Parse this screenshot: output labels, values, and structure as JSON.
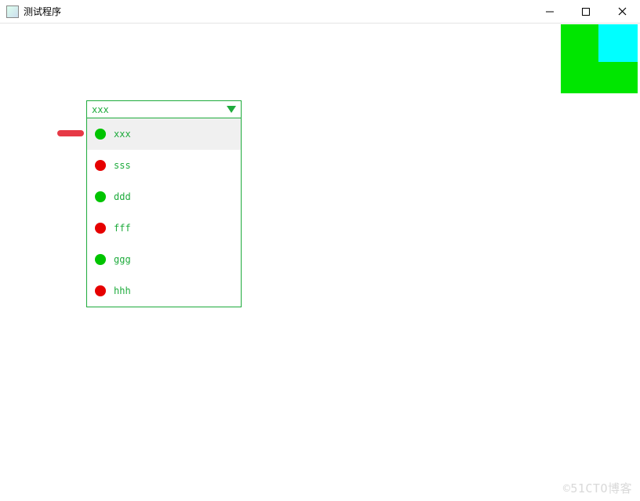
{
  "window": {
    "title": "测试程序"
  },
  "combobox": {
    "selected": "xxx",
    "items": [
      {
        "label": "xxx",
        "status": "green",
        "hover": true
      },
      {
        "label": "sss",
        "status": "red",
        "hover": false
      },
      {
        "label": "ddd",
        "status": "green",
        "hover": false
      },
      {
        "label": "fff",
        "status": "red",
        "hover": false
      },
      {
        "label": "ggg",
        "status": "green",
        "hover": false
      },
      {
        "label": "hhh",
        "status": "red",
        "hover": false
      }
    ]
  },
  "watermark": "©51CTO博客"
}
